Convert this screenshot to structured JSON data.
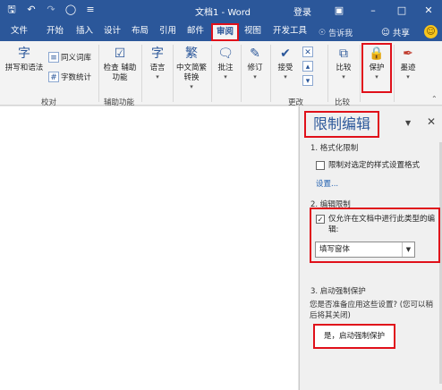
{
  "window": {
    "title": "文档1 - Word",
    "login": "登录"
  },
  "tabs": [
    {
      "label": "文件"
    },
    {
      "label": "开始"
    },
    {
      "label": "插入"
    },
    {
      "label": "设计"
    },
    {
      "label": "布局"
    },
    {
      "label": "引用"
    },
    {
      "label": "邮件"
    },
    {
      "label": "审阅"
    },
    {
      "label": "视图"
    },
    {
      "label": "开发工具"
    }
  ],
  "tell_me": "告诉我",
  "share": "共享",
  "ribbon": {
    "proofing": {
      "spelling": "拼写和语法",
      "thesaurus": "同义词库",
      "word_count": "字数统计",
      "label": "校对"
    },
    "accessibility": {
      "check": "检查",
      "check2": "辅助功能",
      "label": "辅助功能"
    },
    "language": "语言",
    "chinese_convert": "中文简繁",
    "chinese_convert2": "转换",
    "comments": "批注",
    "tracking": "修订",
    "changes": {
      "accept": "接受",
      "label": "更改"
    },
    "compare": {
      "btn": "比较",
      "label": "比较"
    },
    "protect": "保护",
    "ink": "墨迹"
  },
  "panel": {
    "title": "限制编辑",
    "s1": "1. 格式化限制",
    "s1_cb": "限制对选定的样式设置格式",
    "s1_link": "设置...",
    "s2": "2. 编辑限制",
    "s2_cb": "仅允许在文档中进行此类型的编辑:",
    "s2_select": "填写窗体",
    "s3": "3. 启动强制保护",
    "s3_text": "您是否准备应用这些设置? (您可以稍后将其关闭)",
    "s3_btn": "是，启动强制保护"
  },
  "colors": {
    "brand": "#2b579a",
    "highlight": "#e0101a"
  }
}
